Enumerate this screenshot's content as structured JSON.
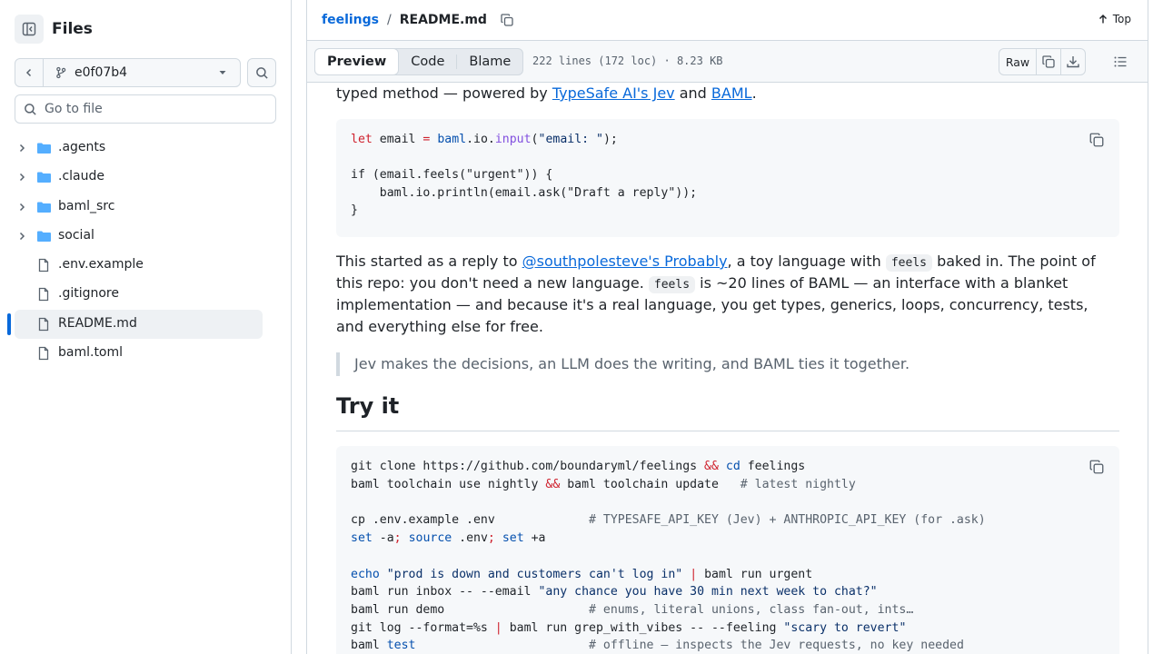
{
  "sidebar": {
    "title": "Files",
    "branch": "e0f07b4",
    "goto_placeholder": "Go to file",
    "items": [
      {
        "label": ".agents",
        "type": "folder"
      },
      {
        "label": ".claude",
        "type": "folder"
      },
      {
        "label": "baml_src",
        "type": "folder"
      },
      {
        "label": "social",
        "type": "folder"
      },
      {
        "label": ".env.example",
        "type": "file"
      },
      {
        "label": ".gitignore",
        "type": "file"
      },
      {
        "label": "README.md",
        "type": "file",
        "active": true
      },
      {
        "label": "baml.toml",
        "type": "file"
      }
    ]
  },
  "header": {
    "repo": "feelings",
    "separator": "/",
    "file": "README.md",
    "top_label": "Top"
  },
  "toolbar": {
    "tabs": [
      "Preview",
      "Code",
      "Blame"
    ],
    "active_tab": "Preview",
    "file_info": "222 lines (172 loc) · 8.23 KB",
    "raw_label": "Raw"
  },
  "readme": {
    "intro": {
      "prefix": "typed method — powered by ",
      "link1": "TypeSafe AI's Jev",
      "middle": " and ",
      "link2": "BAML",
      "suffix": "."
    },
    "code1": [
      {
        "t1": "let",
        "t2": " email ",
        "t3": "=",
        "t4": " ",
        "t5": "baml",
        "t6": ".io.",
        "t7": "input",
        "t8": "(",
        "t9": "\"email: \"",
        "t10": ");"
      },
      {
        "plain": "if (email.feels(\"urgent\")) {"
      },
      {
        "plain": "    baml.io.println(email.ask(\"Draft a reply\"));"
      },
      {
        "plain": "}"
      }
    ],
    "para": {
      "l1_a": "This started as a reply to ",
      "l1_link": "@southpolesteve's Probably",
      "l1_b": ", a toy language with ",
      "l1_code": "feels",
      "l1_c": " baked in. The point of",
      "l2_a": "this repo: you don't need a new language. ",
      "l2_code": "feels",
      "l2_b": " is ~20 lines of BAML — an interface with a blanket",
      "l3": "implementation — and because it's a real language, you get types, generics, loops, concurrency, tests,",
      "l4": "and everything else for free."
    },
    "quote": "Jev makes the decisions, an LLM does the writing, and BAML ties it together.",
    "heading": "Try it",
    "code2": {
      "l1_a": "git clone https://github.com/boundaryml/feelings ",
      "l1_op": "&&",
      "l1_b": " ",
      "l1_cd": "cd",
      "l1_c": " feelings",
      "l2_a": "baml toolchain use nightly ",
      "l2_op": "&&",
      "l2_b": " baml toolchain update   ",
      "l2_com": "# latest nightly",
      "l3_a": "cp .env.example .env             ",
      "l3_com": "# TYPESAFE_API_KEY (Jev) + ANTHROPIC_API_KEY (for .ask)",
      "l4_set1": "set",
      "l4_a": " -a",
      "l4_semi1": ";",
      "l4_sp1": " ",
      "l4_src": "source",
      "l4_b": " .env",
      "l4_semi2": ";",
      "l4_sp2": " ",
      "l4_set2": "set",
      "l4_c": " +a",
      "l5_echo": "echo",
      "l5_sp": " ",
      "l5_str": "\"prod is down and customers can't log in\"",
      "l5_sp2": " ",
      "l5_pipe": "|",
      "l5_b": " baml run urgent",
      "l6_a": "baml run inbox -- --email ",
      "l6_str": "\"any chance you have 30 min next week to chat?\"",
      "l7_a": "baml run demo                    ",
      "l7_com": "# enums, literal unions, class fan-out, ints…",
      "l8_a": "git log --format=%s ",
      "l8_pipe": "|",
      "l8_b": " baml run grep_with_vibes -- --feeling ",
      "l8_str": "\"scary to revert\"",
      "l9_a": "baml ",
      "l9_test": "test",
      "l9_sp": "                        ",
      "l9_com": "# offline — inspects the Jev requests, no key needed"
    }
  },
  "colors": {
    "accent": "#0969da",
    "keyword_red": "#cf222e",
    "keyword_blue": "#0550ae",
    "string": "#0a3069",
    "comment": "#59636e"
  }
}
